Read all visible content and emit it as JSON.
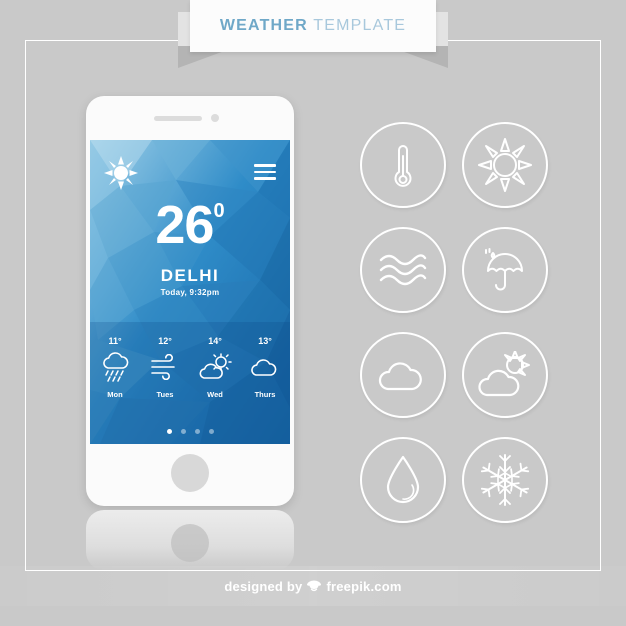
{
  "banner": {
    "title_bold": "WEATHER",
    "title_light": " TEMPLATE"
  },
  "colors": {
    "background": "#c9c9c9",
    "accent_blue": "#6fa8c8",
    "accent_blue_light": "#a8c8dc",
    "screen_blue": "#1f77bd",
    "screen_blue_light": "#7ec0e0",
    "icon_white": "#ffffff"
  },
  "phone": {
    "hardware": {
      "speaker": "speaker-slot",
      "camera": "camera-dot",
      "home_button": "home-button"
    },
    "screen": {
      "status_icon": "sun-icon",
      "menu_icon": "hamburger-icon",
      "temperature": "26",
      "degree_symbol": "0",
      "city": "DELHI",
      "datetime": "Today, 9:32pm",
      "forecast": [
        {
          "temp": "11°",
          "day": "Mon",
          "icon": "rain-cloud-icon"
        },
        {
          "temp": "12°",
          "day": "Tues",
          "icon": "wind-icon"
        },
        {
          "temp": "14°",
          "day": "Wed",
          "icon": "sun-cloud-icon"
        },
        {
          "temp": "13°",
          "day": "Thurs",
          "icon": "cloud-icon"
        }
      ],
      "pagination": {
        "total": 4,
        "active_index": 0
      }
    }
  },
  "icon_grid": [
    {
      "name": "thermometer-icon",
      "label": "Temperature"
    },
    {
      "name": "sun-icon",
      "label": "Sunny"
    },
    {
      "name": "wind-waves-icon",
      "label": "Wind"
    },
    {
      "name": "umbrella-rain-icon",
      "label": "Rain"
    },
    {
      "name": "cloud-icon",
      "label": "Cloudy"
    },
    {
      "name": "sun-behind-cloud-icon",
      "label": "Partly Cloudy"
    },
    {
      "name": "water-drop-icon",
      "label": "Humidity"
    },
    {
      "name": "snowflake-icon",
      "label": "Snow"
    }
  ],
  "footer": {
    "text_before": "designed by",
    "icon": "freepik-bird-icon",
    "text_after": "freepik.com"
  }
}
